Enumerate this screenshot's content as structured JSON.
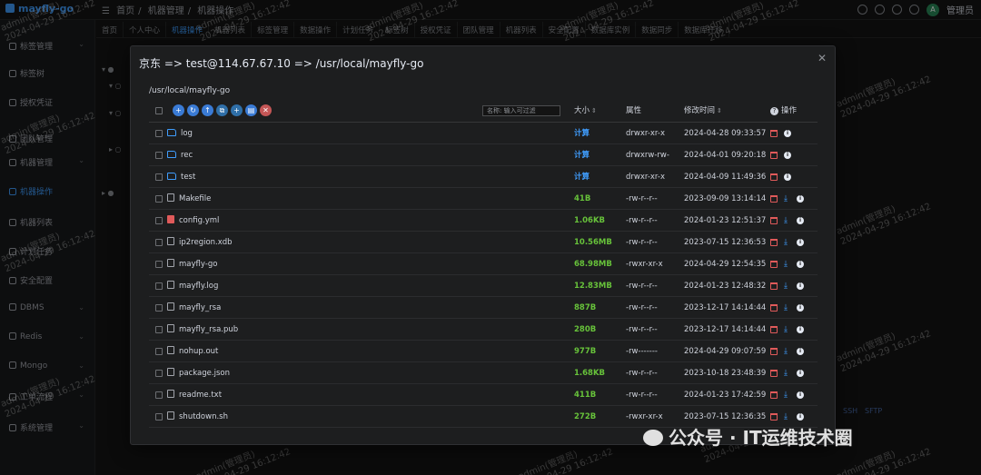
{
  "app": {
    "logo": "mayfly-go"
  },
  "breadcrumb": [
    "首页",
    "机器管理",
    "机器操作"
  ],
  "header": {
    "user_avatar": "A",
    "user_name": "管理员"
  },
  "sidebar": [
    {
      "label": "标签管理",
      "has_children": true
    },
    {
      "label": "标签树",
      "has_children": false
    },
    {
      "label": "授权凭证",
      "has_children": false
    },
    {
      "label": "团队管理",
      "has_children": false
    },
    {
      "label": "机器管理",
      "has_children": true
    },
    {
      "label": "机器操作",
      "has_children": false,
      "active": true
    },
    {
      "label": "机器列表",
      "has_children": false
    },
    {
      "label": "计划任务",
      "has_children": false
    },
    {
      "label": "安全配置",
      "has_children": false
    },
    {
      "label": "DBMS",
      "has_children": true
    },
    {
      "label": "Redis",
      "has_children": true
    },
    {
      "label": "Mongo",
      "has_children": true
    },
    {
      "label": "工单流程",
      "has_children": true
    },
    {
      "label": "系统管理",
      "has_children": true
    }
  ],
  "tabs": [
    "首页",
    "个人中心",
    "机器操作",
    "机器列表",
    "标签管理",
    "数据操作",
    "计划任务",
    "标签树",
    "授权凭证",
    "团队管理",
    "机器列表",
    "安全配置",
    "数据库实例",
    "数据同步",
    "数据库迁移"
  ],
  "background_links": [
    "SSH",
    "SFTP"
  ],
  "watermark": {
    "line1": "admin(管理员)",
    "line2": "2024-04-29 16:12:42"
  },
  "dialog": {
    "title": "京东 => test@114.67.67.10 => /usr/local/mayfly-go",
    "path": "/usr/local/mayfly-go",
    "filter_placeholder": "名称: 输入可过滤",
    "columns": {
      "size": "大小",
      "attr": "属性",
      "modified": "修改时间",
      "actions": "操作"
    },
    "files": [
      {
        "name": "log",
        "type": "folder",
        "size": "计算",
        "attr": "drwxr-xr-x",
        "modified": "2024-04-28 09:33:57"
      },
      {
        "name": "rec",
        "type": "folder",
        "size": "计算",
        "attr": "drwxrw-rw-",
        "modified": "2024-04-01 09:20:18"
      },
      {
        "name": "test",
        "type": "folder",
        "size": "计算",
        "attr": "drwxr-xr-x",
        "modified": "2024-04-09 11:49:36"
      },
      {
        "name": "Makefile",
        "type": "file",
        "size": "41B",
        "attr": "-rw-r--r--",
        "modified": "2023-09-09 13:14:14"
      },
      {
        "name": "config.yml",
        "type": "yml",
        "size": "1.06KB",
        "attr": "-rw-r--r--",
        "modified": "2024-01-23 12:51:37"
      },
      {
        "name": "ip2region.xdb",
        "type": "file",
        "size": "10.56MB",
        "attr": "-rw-r--r--",
        "modified": "2023-07-15 12:36:53"
      },
      {
        "name": "mayfly-go",
        "type": "file",
        "size": "68.98MB",
        "attr": "-rwxr-xr-x",
        "modified": "2024-04-29 12:54:35"
      },
      {
        "name": "mayfly.log",
        "type": "file",
        "size": "12.83MB",
        "attr": "-rw-r--r--",
        "modified": "2024-01-23 12:48:32"
      },
      {
        "name": "mayfly_rsa",
        "type": "file",
        "size": "887B",
        "attr": "-rw-r--r--",
        "modified": "2023-12-17 14:14:44"
      },
      {
        "name": "mayfly_rsa.pub",
        "type": "file",
        "size": "280B",
        "attr": "-rw-r--r--",
        "modified": "2023-12-17 14:14:44"
      },
      {
        "name": "nohup.out",
        "type": "file",
        "size": "977B",
        "attr": "-rw-------",
        "modified": "2024-04-29 09:07:59"
      },
      {
        "name": "package.json",
        "type": "file",
        "size": "1.68KB",
        "attr": "-rw-r--r--",
        "modified": "2023-10-18 23:48:39"
      },
      {
        "name": "readme.txt",
        "type": "file",
        "size": "411B",
        "attr": "-rw-r--r--",
        "modified": "2024-01-23 17:42:59"
      },
      {
        "name": "shutdown.sh",
        "type": "file",
        "size": "272B",
        "attr": "-rwxr-xr-x",
        "modified": "2023-07-15 12:36:35"
      }
    ]
  },
  "footer": {
    "wechat": "公众号 · IT运维技术圈"
  }
}
